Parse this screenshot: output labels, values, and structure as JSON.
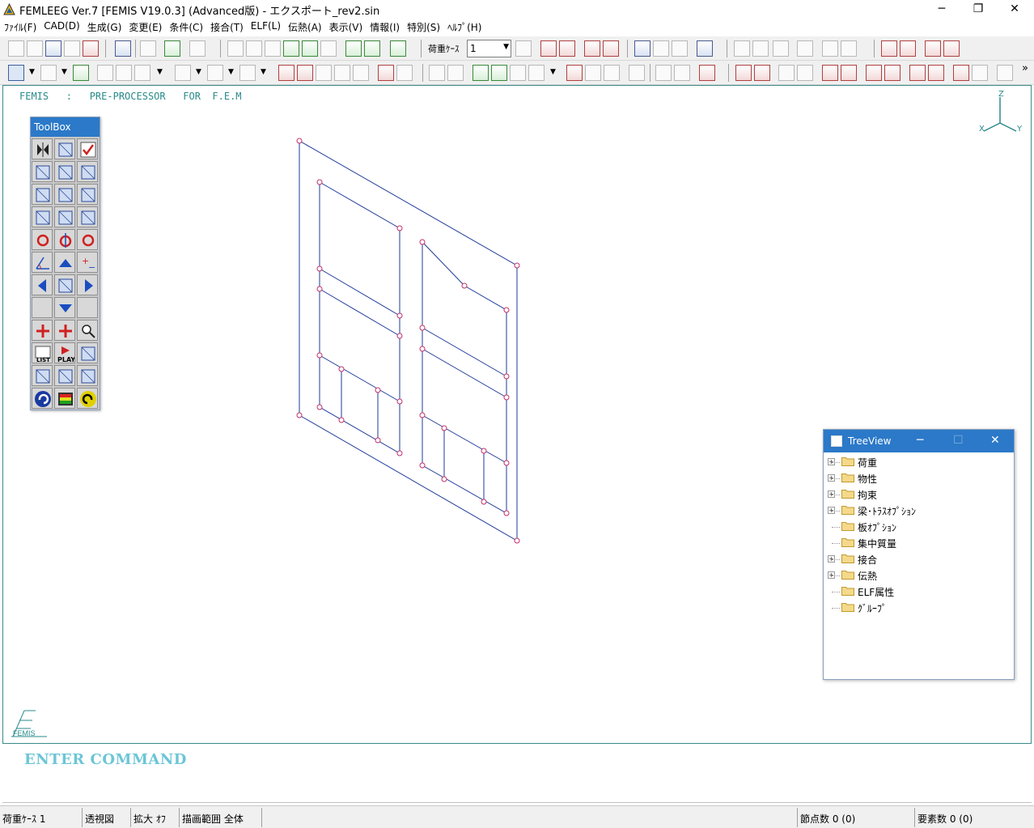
{
  "window": {
    "title": "FEMLEEG Ver.7 [FEMIS V19.0.3] (Advanced版) - エクスポート_rev2.sin",
    "minimize": "─",
    "maximize": "❐",
    "close": "✕"
  },
  "menu": [
    "ﾌｧｲﾙ(F)",
    "CAD(D)",
    "生成(G)",
    "変更(E)",
    "条件(C)",
    "接合(T)",
    "ELF(L)",
    "伝熱(A)",
    "表示(V)",
    "情報(I)",
    "特別(S)",
    "ﾍﾙﾌﾟ(H)"
  ],
  "toolbar1": {
    "load_case_label": "荷重ｹｰｽ",
    "load_case_value": "1"
  },
  "toolbar2": {
    "overflow": "»"
  },
  "canvas": {
    "header": "FEMIS   :   PRE-PROCESSOR   FOR  F.E.M",
    "axis_labels": {
      "x": "X",
      "y": "Y",
      "z": "Z"
    }
  },
  "toolbox": {
    "title": "ToolBox",
    "play_label": "PLAY",
    "list_label": "LIST"
  },
  "treeview": {
    "title": "TreeView",
    "items": [
      {
        "label": "荷重",
        "expandable": true
      },
      {
        "label": "物性",
        "expandable": true
      },
      {
        "label": "拘束",
        "expandable": true
      },
      {
        "label": "梁･ﾄﾗｽｵﾌﾟｼｮﾝ",
        "expandable": true
      },
      {
        "label": "板ｵﾌﾟｼｮﾝ",
        "expandable": false
      },
      {
        "label": "集中質量",
        "expandable": false
      },
      {
        "label": "接合",
        "expandable": true
      },
      {
        "label": "伝熱",
        "expandable": true
      },
      {
        "label": "ELF属性",
        "expandable": false
      },
      {
        "label": "ｸﾞﾙｰﾌﾟ",
        "expandable": false
      }
    ]
  },
  "logo": "FEMIS",
  "command": "ENTER COMMAND",
  "status": {
    "load_case": "荷重ｹｰｽ 1",
    "view": "透視図",
    "zoom": "拡大 ｵﾌ",
    "range": "描画範囲 全体",
    "nodes": "節点数 0 (0)",
    "elements": "要素数 0 (0)"
  },
  "colors": {
    "accent": "#2b79c8",
    "model_line": "#1f3a9a",
    "node_marker": "#c0306a",
    "header_text": "#2a8a8a",
    "command_text": "#6cc6d6"
  }
}
